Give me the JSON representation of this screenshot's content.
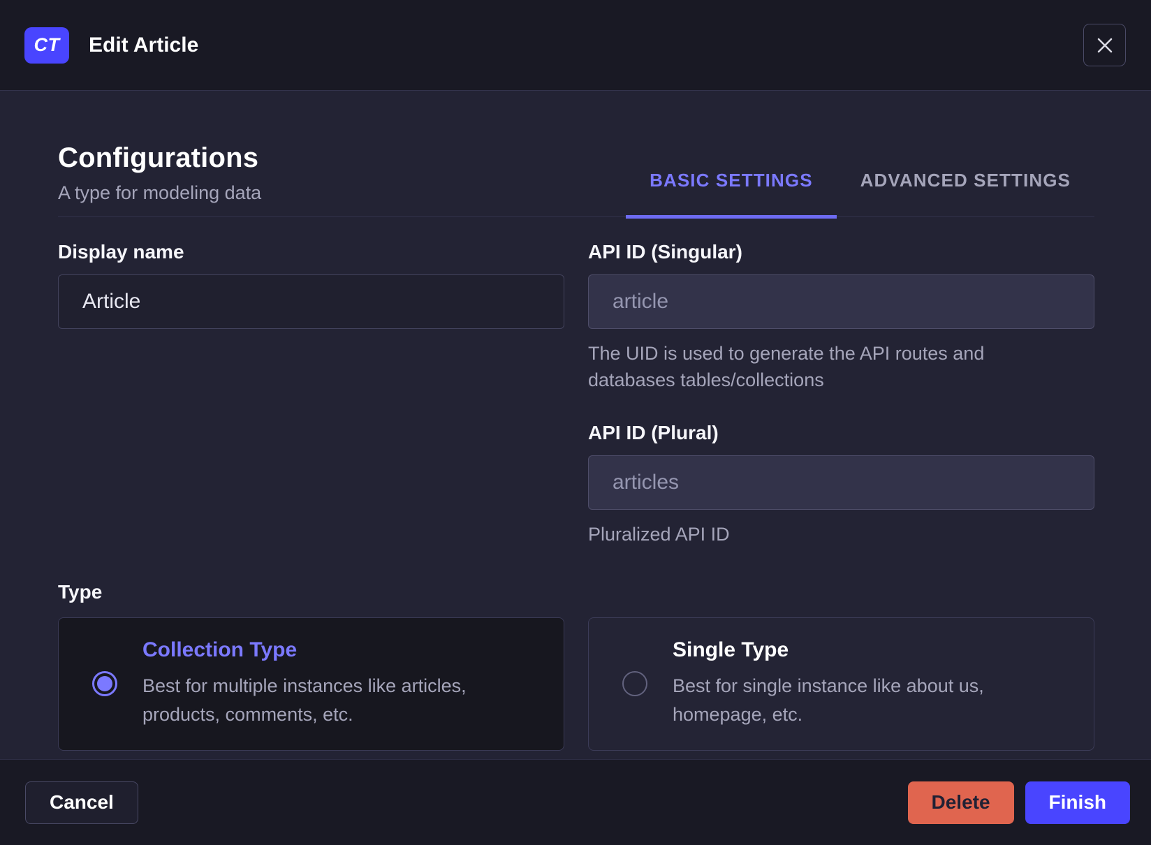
{
  "header": {
    "badge": "CT",
    "title": "Edit Article"
  },
  "section": {
    "title": "Configurations",
    "subtitle": "A type for modeling data"
  },
  "tabs": [
    {
      "label": "BASIC SETTINGS",
      "active": true
    },
    {
      "label": "ADVANCED SETTINGS",
      "active": false
    }
  ],
  "fields": {
    "display_name": {
      "label": "Display name",
      "value": "Article"
    },
    "api_id_singular": {
      "label": "API ID (Singular)",
      "value": "article",
      "hint": "The UID is used to generate the API routes and databases tables/collections"
    },
    "api_id_plural": {
      "label": "API ID (Plural)",
      "value": "articles",
      "hint": "Pluralized API ID"
    }
  },
  "type": {
    "label": "Type",
    "options": [
      {
        "title": "Collection Type",
        "description": "Best for multiple instances like articles, products, comments, etc.",
        "selected": true
      },
      {
        "title": "Single Type",
        "description": "Best for single instance like about us, homepage, etc.",
        "selected": false
      }
    ]
  },
  "footer": {
    "cancel_label": "Cancel",
    "delete_label": "Delete",
    "finish_label": "Finish"
  },
  "colors": {
    "accent_purple": "#4945ff",
    "accent_purple_light": "#7b79ff",
    "danger": "#e0654f",
    "body_bg": "#232334",
    "chrome_bg": "#191924",
    "muted_text": "#a5a5ba"
  }
}
